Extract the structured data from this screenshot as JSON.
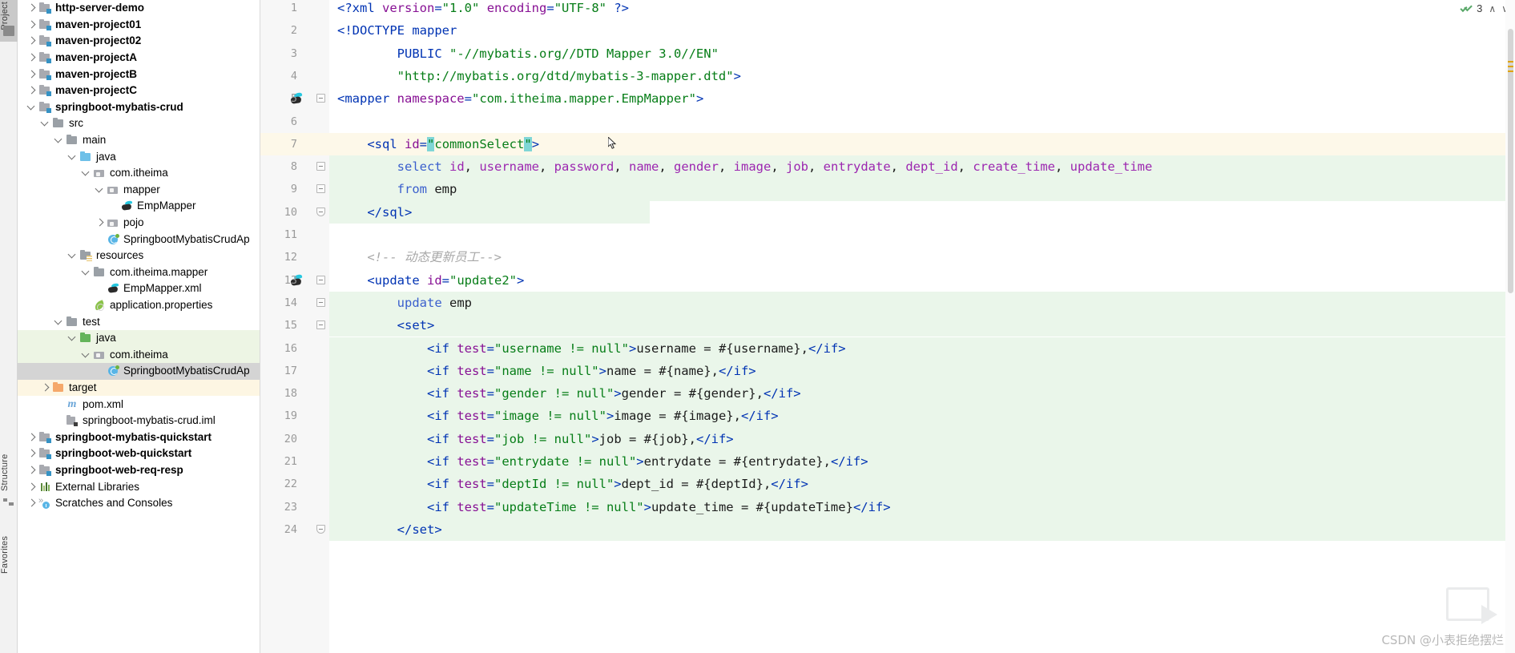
{
  "toolwindows": {
    "top_label": "Project",
    "bottom_labels": [
      "Structure",
      "Favorites"
    ]
  },
  "project_tree": {
    "items": [
      {
        "label": "http-server-demo",
        "depth": 1,
        "arrow": "right",
        "icon": "module-icon",
        "bold": true,
        "state": "none"
      },
      {
        "label": "maven-project01",
        "depth": 1,
        "arrow": "right",
        "icon": "module-icon",
        "bold": true,
        "state": "none"
      },
      {
        "label": "maven-project02",
        "depth": 1,
        "arrow": "right",
        "icon": "module-icon",
        "bold": true,
        "state": "none"
      },
      {
        "label": "maven-projectA",
        "depth": 1,
        "arrow": "right",
        "icon": "module-icon",
        "bold": true,
        "state": "none"
      },
      {
        "label": "maven-projectB",
        "depth": 1,
        "arrow": "right",
        "icon": "module-icon",
        "bold": true,
        "state": "none"
      },
      {
        "label": "maven-projectC",
        "depth": 1,
        "arrow": "right",
        "icon": "module-icon",
        "bold": true,
        "state": "none"
      },
      {
        "label": "springboot-mybatis-crud",
        "depth": 1,
        "arrow": "down",
        "icon": "module-icon",
        "bold": true,
        "state": "none"
      },
      {
        "label": "src",
        "depth": 2,
        "arrow": "down",
        "icon": "folder-icon",
        "bold": false,
        "state": "none"
      },
      {
        "label": "main",
        "depth": 3,
        "arrow": "down",
        "icon": "folder-icon",
        "bold": false,
        "state": "none"
      },
      {
        "label": "java",
        "depth": 4,
        "arrow": "down",
        "icon": "folder-blue-icon",
        "bold": false,
        "state": "none"
      },
      {
        "label": "com.itheima",
        "depth": 5,
        "arrow": "down",
        "icon": "package-icon",
        "bold": false,
        "state": "none"
      },
      {
        "label": "mapper",
        "depth": 6,
        "arrow": "down",
        "icon": "package-icon",
        "bold": false,
        "state": "none"
      },
      {
        "label": "EmpMapper",
        "depth": 7,
        "arrow": "none",
        "icon": "mybatis-mapper-icon",
        "bold": false,
        "state": "none"
      },
      {
        "label": "pojo",
        "depth": 6,
        "arrow": "right",
        "icon": "package-icon",
        "bold": false,
        "state": "none"
      },
      {
        "label": "SpringbootMybatisCrudAp",
        "depth": 6,
        "arrow": "none",
        "icon": "springboot-class-icon",
        "bold": false,
        "state": "none"
      },
      {
        "label": "resources",
        "depth": 4,
        "arrow": "down",
        "icon": "resources-folder-icon",
        "bold": false,
        "state": "none"
      },
      {
        "label": "com.itheima.mapper",
        "depth": 5,
        "arrow": "down",
        "icon": "folder-icon",
        "bold": false,
        "state": "none"
      },
      {
        "label": "EmpMapper.xml",
        "depth": 6,
        "arrow": "none",
        "icon": "mybatis-xml-icon",
        "bold": false,
        "state": "none"
      },
      {
        "label": "application.properties",
        "depth": 5,
        "arrow": "none",
        "icon": "spring-properties-icon",
        "bold": false,
        "state": "none"
      },
      {
        "label": "test",
        "depth": 3,
        "arrow": "down",
        "icon": "folder-icon",
        "bold": false,
        "state": "none"
      },
      {
        "label": "java",
        "depth": 4,
        "arrow": "down",
        "icon": "folder-green-icon",
        "bold": false,
        "state": "green"
      },
      {
        "label": "com.itheima",
        "depth": 5,
        "arrow": "down",
        "icon": "package-icon",
        "bold": false,
        "state": "green"
      },
      {
        "label": "SpringbootMybatisCrudAp",
        "depth": 6,
        "arrow": "none",
        "icon": "java-class-icon",
        "bold": false,
        "state": "selected"
      },
      {
        "label": "target",
        "depth": 2,
        "arrow": "right",
        "icon": "folder-orange-icon",
        "bold": false,
        "state": "yellow"
      },
      {
        "label": "pom.xml",
        "depth": 3,
        "arrow": "none",
        "icon": "maven-icon",
        "bold": false,
        "state": "none"
      },
      {
        "label": "springboot-mybatis-crud.iml",
        "depth": 3,
        "arrow": "none",
        "icon": "iml-icon",
        "bold": false,
        "state": "none"
      },
      {
        "label": "springboot-mybatis-quickstart",
        "depth": 1,
        "arrow": "right",
        "icon": "module-icon",
        "bold": true,
        "state": "none"
      },
      {
        "label": "springboot-web-quickstart",
        "depth": 1,
        "arrow": "right",
        "icon": "module-icon",
        "bold": true,
        "state": "none"
      },
      {
        "label": "springboot-web-req-resp",
        "depth": 1,
        "arrow": "right",
        "icon": "module-icon",
        "bold": true,
        "state": "none"
      },
      {
        "label": "External Libraries",
        "depth": 1,
        "arrow": "right",
        "icon": "libraries-icon",
        "bold": false,
        "state": "none"
      },
      {
        "label": "Scratches and Consoles",
        "depth": 1,
        "arrow": "right",
        "icon": "scratches-icon",
        "bold": false,
        "state": "none"
      }
    ]
  },
  "editor": {
    "language": "XML",
    "lines": [
      {
        "n": 1,
        "indent": 0,
        "bg": "none",
        "gutter": "none",
        "fold": "none",
        "tokens": [
          {
            "t": "tag",
            "v": "<?xml "
          },
          {
            "t": "attr",
            "v": "version"
          },
          {
            "t": "tag",
            "v": "="
          },
          {
            "t": "val",
            "v": "\"1.0\""
          },
          {
            "t": "tag",
            "v": " "
          },
          {
            "t": "attr",
            "v": "encoding"
          },
          {
            "t": "tag",
            "v": "="
          },
          {
            "t": "val",
            "v": "\"UTF-8\""
          },
          {
            "t": "tag",
            "v": " ?>"
          }
        ]
      },
      {
        "n": 2,
        "indent": 0,
        "bg": "none",
        "gutter": "none",
        "fold": "none",
        "tokens": [
          {
            "t": "tag",
            "v": "<!DOCTYPE mapper"
          }
        ]
      },
      {
        "n": 3,
        "indent": 0,
        "bg": "none",
        "gutter": "none",
        "fold": "none",
        "tokens": [
          {
            "t": "tag",
            "v": "        PUBLIC "
          },
          {
            "t": "val",
            "v": "\"-//mybatis.org//DTD Mapper 3.0//EN\""
          }
        ]
      },
      {
        "n": 4,
        "indent": 0,
        "bg": "none",
        "gutter": "none",
        "fold": "none",
        "tokens": [
          {
            "t": "val",
            "v": "        \"http://mybatis.org/dtd/mybatis-3-mapper.dtd\""
          },
          {
            "t": "tag",
            "v": ">"
          }
        ]
      },
      {
        "n": 5,
        "indent": 0,
        "bg": "none",
        "gutter": "mybatis",
        "fold": "open",
        "tokens": [
          {
            "t": "tag",
            "v": "<mapper "
          },
          {
            "t": "attr",
            "v": "namespace"
          },
          {
            "t": "tag",
            "v": "="
          },
          {
            "t": "val",
            "v": "\"com.itheima.mapper.EmpMapper\""
          },
          {
            "t": "tag",
            "v": ">"
          }
        ]
      },
      {
        "n": 6,
        "indent": 0,
        "bg": "none",
        "gutter": "none",
        "fold": "none",
        "tokens": []
      },
      {
        "n": 7,
        "indent": 0,
        "bg": "caret",
        "gutter": "bulb",
        "fold": "open",
        "tokens": [
          {
            "t": "tag",
            "v": "    <sql "
          },
          {
            "t": "attr",
            "v": "id"
          },
          {
            "t": "tag",
            "v": "="
          },
          {
            "t": "qhl",
            "v": "\""
          },
          {
            "t": "val",
            "v": "commonSelect"
          },
          {
            "t": "qhl",
            "v": "\""
          },
          {
            "t": "tag",
            "v": ">"
          }
        ]
      },
      {
        "n": 8,
        "indent": 0,
        "bg": "green",
        "gutter": "none",
        "fold": "open",
        "tokens": [
          {
            "t": "kw",
            "v": "        select "
          },
          {
            "t": "col",
            "v": "id"
          },
          {
            "t": "plain",
            "v": ", "
          },
          {
            "t": "col",
            "v": "username"
          },
          {
            "t": "plain",
            "v": ", "
          },
          {
            "t": "col",
            "v": "password"
          },
          {
            "t": "plain",
            "v": ", "
          },
          {
            "t": "col",
            "v": "name"
          },
          {
            "t": "plain",
            "v": ", "
          },
          {
            "t": "col",
            "v": "gender"
          },
          {
            "t": "plain",
            "v": ", "
          },
          {
            "t": "col",
            "v": "image"
          },
          {
            "t": "plain",
            "v": ", "
          },
          {
            "t": "col",
            "v": "job"
          },
          {
            "t": "plain",
            "v": ", "
          },
          {
            "t": "col",
            "v": "entrydate"
          },
          {
            "t": "plain",
            "v": ", "
          },
          {
            "t": "col",
            "v": "dept_id"
          },
          {
            "t": "plain",
            "v": ", "
          },
          {
            "t": "col",
            "v": "create_time"
          },
          {
            "t": "plain",
            "v": ", "
          },
          {
            "t": "col",
            "v": "update_time"
          }
        ]
      },
      {
        "n": 9,
        "indent": 0,
        "bg": "green",
        "gutter": "none",
        "fold": "close",
        "tokens": [
          {
            "t": "kw",
            "v": "        from "
          },
          {
            "t": "plain",
            "v": "emp"
          }
        ]
      },
      {
        "n": 10,
        "indent": 0,
        "bg": "green-end",
        "gutter": "none",
        "fold": "cap",
        "tokens": [
          {
            "t": "tag",
            "v": "    </sql>"
          }
        ]
      },
      {
        "n": 11,
        "indent": 0,
        "bg": "none",
        "gutter": "none",
        "fold": "none",
        "tokens": []
      },
      {
        "n": 12,
        "indent": 0,
        "bg": "none",
        "gutter": "none",
        "fold": "none",
        "tokens": [
          {
            "t": "cmt",
            "v": "    <!-- 动态更新员工-->"
          }
        ]
      },
      {
        "n": 13,
        "indent": 0,
        "bg": "none",
        "gutter": "mybatis",
        "fold": "open",
        "tokens": [
          {
            "t": "tag",
            "v": "    <update "
          },
          {
            "t": "attr",
            "v": "id"
          },
          {
            "t": "tag",
            "v": "="
          },
          {
            "t": "val",
            "v": "\"update2\""
          },
          {
            "t": "tag",
            "v": ">"
          }
        ]
      },
      {
        "n": 14,
        "indent": 0,
        "bg": "green",
        "gutter": "none",
        "fold": "open",
        "tokens": [
          {
            "t": "kw",
            "v": "        update "
          },
          {
            "t": "plain",
            "v": "emp"
          }
        ]
      },
      {
        "n": 15,
        "indent": 0,
        "bg": "green",
        "gutter": "none",
        "fold": "open",
        "tokens": [
          {
            "t": "tag",
            "v": "        <set>"
          }
        ]
      },
      {
        "n": 16,
        "indent": 0,
        "bg": "green",
        "gutter": "none",
        "fold": "none",
        "tokens": [
          {
            "t": "tag",
            "v": "            <if "
          },
          {
            "t": "attr",
            "v": "test"
          },
          {
            "t": "tag",
            "v": "="
          },
          {
            "t": "val",
            "v": "\"username != null\""
          },
          {
            "t": "tag",
            "v": ">"
          },
          {
            "t": "plain",
            "v": "username = #{username},"
          },
          {
            "t": "tag",
            "v": "</if>"
          }
        ]
      },
      {
        "n": 17,
        "indent": 0,
        "bg": "green",
        "gutter": "none",
        "fold": "none",
        "tokens": [
          {
            "t": "tag",
            "v": "            <if "
          },
          {
            "t": "attr",
            "v": "test"
          },
          {
            "t": "tag",
            "v": "="
          },
          {
            "t": "val",
            "v": "\"name != null\""
          },
          {
            "t": "tag",
            "v": ">"
          },
          {
            "t": "plain",
            "v": "name = #{name},"
          },
          {
            "t": "tag",
            "v": "</if>"
          }
        ]
      },
      {
        "n": 18,
        "indent": 0,
        "bg": "green",
        "gutter": "none",
        "fold": "none",
        "tokens": [
          {
            "t": "tag",
            "v": "            <if "
          },
          {
            "t": "attr",
            "v": "test"
          },
          {
            "t": "tag",
            "v": "="
          },
          {
            "t": "val",
            "v": "\"gender != null\""
          },
          {
            "t": "tag",
            "v": ">"
          },
          {
            "t": "plain",
            "v": "gender = #{gender},"
          },
          {
            "t": "tag",
            "v": "</if>"
          }
        ]
      },
      {
        "n": 19,
        "indent": 0,
        "bg": "green",
        "gutter": "none",
        "fold": "none",
        "tokens": [
          {
            "t": "tag",
            "v": "            <if "
          },
          {
            "t": "attr",
            "v": "test"
          },
          {
            "t": "tag",
            "v": "="
          },
          {
            "t": "val",
            "v": "\"image != null\""
          },
          {
            "t": "tag",
            "v": ">"
          },
          {
            "t": "plain",
            "v": "image = #{image},"
          },
          {
            "t": "tag",
            "v": "</if>"
          }
        ]
      },
      {
        "n": 20,
        "indent": 0,
        "bg": "green",
        "gutter": "none",
        "fold": "none",
        "tokens": [
          {
            "t": "tag",
            "v": "            <if "
          },
          {
            "t": "attr",
            "v": "test"
          },
          {
            "t": "tag",
            "v": "="
          },
          {
            "t": "val",
            "v": "\"job != null\""
          },
          {
            "t": "tag",
            "v": ">"
          },
          {
            "t": "plain",
            "v": "job = #{job},"
          },
          {
            "t": "tag",
            "v": "</if>"
          }
        ]
      },
      {
        "n": 21,
        "indent": 0,
        "bg": "green",
        "gutter": "none",
        "fold": "none",
        "tokens": [
          {
            "t": "tag",
            "v": "            <if "
          },
          {
            "t": "attr",
            "v": "test"
          },
          {
            "t": "tag",
            "v": "="
          },
          {
            "t": "val",
            "v": "\"entrydate != null\""
          },
          {
            "t": "tag",
            "v": ">"
          },
          {
            "t": "plain",
            "v": "entrydate = #{entrydate},"
          },
          {
            "t": "tag",
            "v": "</if>"
          }
        ]
      },
      {
        "n": 22,
        "indent": 0,
        "bg": "green",
        "gutter": "none",
        "fold": "none",
        "tokens": [
          {
            "t": "tag",
            "v": "            <if "
          },
          {
            "t": "attr",
            "v": "test"
          },
          {
            "t": "tag",
            "v": "="
          },
          {
            "t": "val",
            "v": "\"deptId != null\""
          },
          {
            "t": "tag",
            "v": ">"
          },
          {
            "t": "plain",
            "v": "dept_id = #{deptId},"
          },
          {
            "t": "tag",
            "v": "</if>"
          }
        ]
      },
      {
        "n": 23,
        "indent": 0,
        "bg": "green",
        "gutter": "none",
        "fold": "none",
        "tokens": [
          {
            "t": "tag",
            "v": "            <if "
          },
          {
            "t": "attr",
            "v": "test"
          },
          {
            "t": "tag",
            "v": "="
          },
          {
            "t": "val",
            "v": "\"updateTime != null\""
          },
          {
            "t": "tag",
            "v": ">"
          },
          {
            "t": "plain",
            "v": "update_time = #{updateTime}"
          },
          {
            "t": "tag",
            "v": "</if>"
          }
        ]
      },
      {
        "n": 24,
        "indent": 0,
        "bg": "green",
        "gutter": "none",
        "fold": "cap",
        "tokens": [
          {
            "t": "tag",
            "v": "        </set>"
          }
        ]
      }
    ]
  },
  "inspection_widget": {
    "warning_count": "3",
    "up_caret": "∧",
    "down_caret": "∨"
  },
  "watermark": {
    "text": "CSDN @小表拒绝摆烂"
  }
}
